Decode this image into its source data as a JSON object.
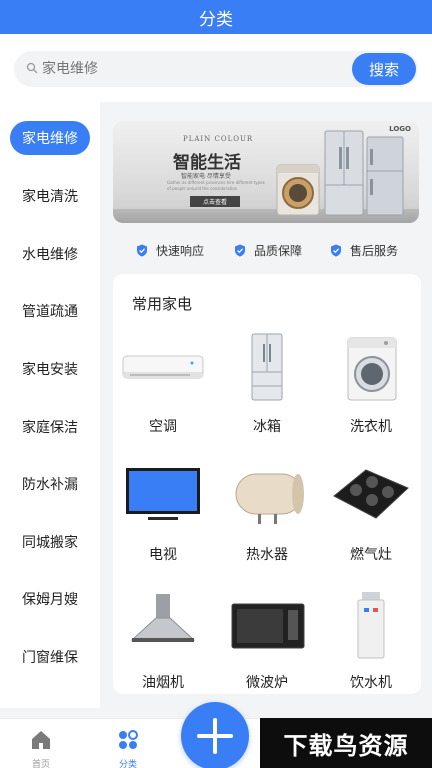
{
  "header": {
    "title": "分类"
  },
  "search": {
    "placeholder": "家电维修",
    "button_label": "搜索"
  },
  "sidebar": {
    "items": [
      {
        "label": "家电维修",
        "active": true
      },
      {
        "label": "家电清洗"
      },
      {
        "label": "水电维修"
      },
      {
        "label": "管道疏通"
      },
      {
        "label": "家电安装"
      },
      {
        "label": "家庭保洁"
      },
      {
        "label": "防水补漏"
      },
      {
        "label": "同城搬家"
      },
      {
        "label": "保姆月嫂"
      },
      {
        "label": "门窗维保"
      }
    ]
  },
  "banner": {
    "logo": "LOGO",
    "tagline": "PLAIN COLOUR",
    "title": "智能生活",
    "subtitle": "智能家电 尽情享受",
    "fine_print": "Gather as different provinces hire different types of people around the consideration",
    "button_label": "点击查看"
  },
  "features": [
    {
      "label": "快速响应"
    },
    {
      "label": "品质保障"
    },
    {
      "label": "售后服务"
    }
  ],
  "section": {
    "title": "常用家电",
    "items": [
      {
        "label": "空调",
        "icon": "air-conditioner"
      },
      {
        "label": "冰箱",
        "icon": "refrigerator"
      },
      {
        "label": "洗衣机",
        "icon": "washing-machine"
      },
      {
        "label": "电视",
        "icon": "television"
      },
      {
        "label": "热水器",
        "icon": "water-heater"
      },
      {
        "label": "燃气灶",
        "icon": "gas-stove"
      },
      {
        "label": "油烟机",
        "icon": "range-hood"
      },
      {
        "label": "微波炉",
        "icon": "microwave"
      },
      {
        "label": "饮水机",
        "icon": "water-dispenser"
      }
    ]
  },
  "tabbar": {
    "items": [
      {
        "label": "首页",
        "icon": "home-icon"
      },
      {
        "label": "分类",
        "icon": "category-icon",
        "active": true
      }
    ],
    "fab_icon": "plus-icon"
  },
  "watermark": {
    "text": "下载鸟资源"
  },
  "colors": {
    "primary": "#3a7ef5",
    "background": "#f3f4f6",
    "card": "#ffffff"
  }
}
